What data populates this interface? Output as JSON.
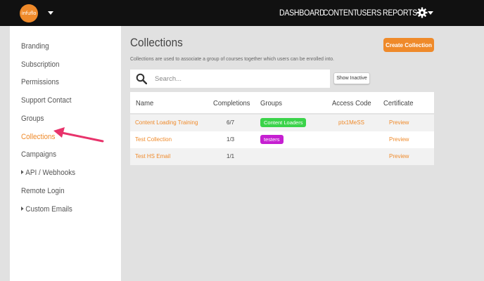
{
  "header": {
    "logo_text": "infuflo",
    "nav": [
      {
        "label": "DASHBOARD"
      },
      {
        "label": "CONTENT"
      },
      {
        "label": "USERS"
      },
      {
        "label": "REPORTS"
      }
    ]
  },
  "sidebar": {
    "items": [
      {
        "label": "Branding"
      },
      {
        "label": "Subscription"
      },
      {
        "label": "Permissions"
      },
      {
        "label": "Support Contact"
      },
      {
        "label": "Groups"
      },
      {
        "label": "Collections"
      },
      {
        "label": "Campaigns"
      },
      {
        "label": "API / Webhooks"
      },
      {
        "label": "Remote Login"
      },
      {
        "label": "Custom Emails"
      }
    ]
  },
  "main": {
    "title": "Collections",
    "description": "Collections are used to associate a group of courses together which users can be enrolled into.",
    "create_button": "Create Collection",
    "search_placeholder": "Search...",
    "show_inactive_button": "Show Inactive",
    "table": {
      "headers": [
        "Name",
        "Completions",
        "Groups",
        "Access Code",
        "Certificate"
      ],
      "rows": [
        {
          "name": "Content Loading Training",
          "completions": "6/7",
          "group": "Content Loaders",
          "access_code": "ptx1MeSS",
          "certificate": "Preview"
        },
        {
          "name": "Test Collection",
          "completions": "1/3",
          "group": "testers",
          "access_code": "",
          "certificate": "Preview"
        },
        {
          "name": "Test HS Email",
          "completions": "1/1",
          "group": "",
          "access_code": "",
          "certificate": "Preview"
        }
      ]
    }
  },
  "colors": {
    "accent": "#ef8a2a",
    "topbar": "#111111",
    "badge_content_loaders": "#3bd34a",
    "badge_testers": "#c51fd1",
    "annotation_arrow": "#e8336b"
  }
}
